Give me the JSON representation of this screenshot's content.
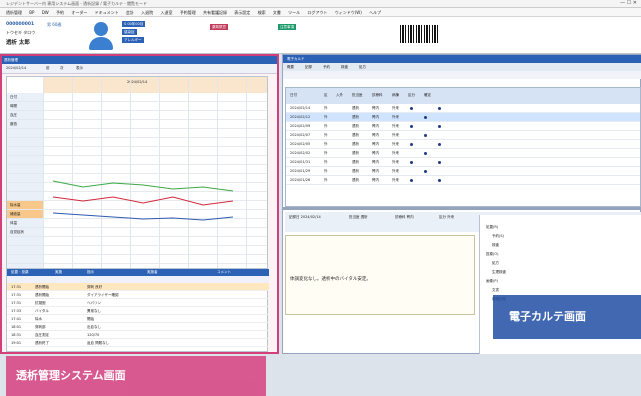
{
  "window": {
    "title": "レジデントサーバー内 専用システム画面 - 透析記録 / 電子カルテ - 閲覧モード"
  },
  "menu": [
    "透析管理",
    "BP",
    "DW",
    "予約",
    "オーダー",
    "ドキュメント",
    "会計",
    "入退院",
    "入退室",
    "予約管理",
    "共有看護記録",
    "表示設定",
    "検索",
    "文書",
    "ツール",
    "ログアウト",
    "ウィンドウ(W)",
    "ヘルプ"
  ],
  "patient": {
    "id": "000000001",
    "kana": "トウセキ タロウ",
    "name": "透析 太郎",
    "sex_age": "男 60歳",
    "blue": "S 00年00月",
    "badges": [
      "感染症",
      "アレルギー",
      "薬剤禁忌",
      "注意事項"
    ]
  },
  "left": {
    "header": "透析管理",
    "tools": [
      "2024/02/14",
      "前",
      "次",
      "表示"
    ],
    "date_label": "2024/02/14",
    "rows": [
      "日付",
      "時間",
      "血圧",
      "脈拍",
      "",
      "",
      "",
      "",
      "",
      "",
      "",
      "",
      "除水量",
      "補液量",
      "体温",
      "自覚症状",
      "",
      "",
      "",
      "",
      "",
      ""
    ],
    "bottom_tabs": [
      "処置・投薬",
      "実施",
      "指示",
      "実施者",
      "コメント"
    ],
    "bottom_rows": [
      {
        "time": "17:31",
        "text": "透析開始",
        "detail": "穿刺 良好"
      },
      {
        "time": "17:31",
        "text": "透析開始",
        "detail": "ダイアライザー確認"
      },
      {
        "time": "17:31",
        "text": "抗凝固",
        "detail": "ヘパリン"
      },
      {
        "time": "17:33",
        "text": "バイタル",
        "detail": "異常なし"
      },
      {
        "time": "17:41",
        "text": "除水",
        "detail": "開始"
      },
      {
        "time": "18:01",
        "text": "穿刺部",
        "detail": "出血なし"
      },
      {
        "time": "18:31",
        "text": "血圧測定",
        "detail": "120/70"
      },
      {
        "time": "19:01",
        "text": "透析終了",
        "detail": "返血 問題なし"
      }
    ],
    "banner": "透析管理システム画面"
  },
  "right": {
    "header": "電子カルテ",
    "tabs": [
      "概要",
      "記録",
      "予約",
      "検査",
      "処方"
    ],
    "table_head": [
      "日付",
      "区",
      "入外",
      "担当医",
      "診療科",
      "病棟",
      "区分",
      "確定",
      "",
      "",
      "",
      "",
      "",
      ""
    ],
    "rows": [
      {
        "date": "2024/02/14",
        "kind": "外",
        "dr": "透析",
        "dept": "腎内",
        "ward": "外来"
      },
      {
        "date": "2024/02/12",
        "kind": "外",
        "dr": "透析",
        "dept": "腎内",
        "ward": "外来"
      },
      {
        "date": "2024/02/09",
        "kind": "外",
        "dr": "透析",
        "dept": "腎内",
        "ward": "外来"
      },
      {
        "date": "2024/02/07",
        "kind": "外",
        "dr": "透析",
        "dept": "腎内",
        "ward": "外来"
      },
      {
        "date": "2024/02/05",
        "kind": "外",
        "dr": "透析",
        "dept": "腎内",
        "ward": "外来"
      },
      {
        "date": "2024/02/02",
        "kind": "外",
        "dr": "透析",
        "dept": "腎内",
        "ward": "外来"
      },
      {
        "date": "2024/01/31",
        "kind": "外",
        "dr": "透析",
        "dept": "腎内",
        "ward": "外来"
      },
      {
        "date": "2024/01/29",
        "kind": "外",
        "dr": "透析",
        "dept": "腎内",
        "ward": "外来"
      },
      {
        "date": "2024/01/26",
        "kind": "外",
        "dr": "透析",
        "dept": "腎内",
        "ward": "外来"
      }
    ],
    "note_head": [
      "記録日 2024/02/14",
      "担当医 透析",
      "診療科 腎内",
      "区分 外来"
    ],
    "note_text": "体調変化なし。透析中のバイタル安定。",
    "tree": [
      "処置(R)",
      "予約(S)",
      "検査",
      "投薬(O)",
      "処方",
      "生理検査",
      "画像(P)",
      "文書",
      "看護記録"
    ],
    "banner": "電子カルテ画面"
  }
}
